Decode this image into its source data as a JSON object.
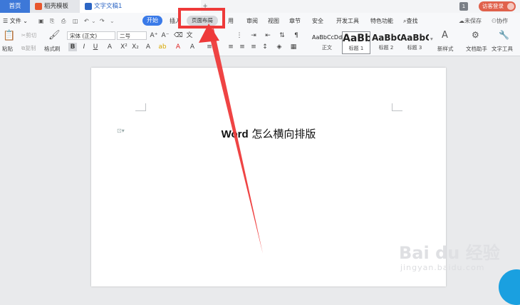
{
  "tabs": {
    "home": "首页",
    "daoke": "稻壳模板",
    "doc": "文字文稿1",
    "add": "+"
  },
  "window": {
    "page_badge": "1",
    "guest_login": "访客登录"
  },
  "menu": {
    "file": "文件",
    "start": "开始",
    "insert": "插入",
    "layout": "页面布局",
    "reference": "用",
    "review": "审阅",
    "view": "视图",
    "chapter": "章节",
    "security": "安全",
    "devtools": "开发工具",
    "features": "特色功能",
    "search": "查找",
    "unsaved": "未保存",
    "collab": "协作"
  },
  "ribbon": {
    "paste": "粘贴",
    "cut": "剪切",
    "copy": "复制",
    "format_painter": "格式刷",
    "font_name": "宋体 (正文)",
    "font_size": "二号",
    "styles": [
      {
        "preview": "AaBbCcDd",
        "caption": "正文"
      },
      {
        "preview": "AaBb",
        "caption": "标题 1"
      },
      {
        "preview": "AaBbC",
        "caption": "标题 2"
      },
      {
        "preview": "AaBbC",
        "caption": "标题 3"
      }
    ],
    "new_style": "新样式",
    "doc_assistant": "文档助手",
    "text_tools": "文字工具"
  },
  "document": {
    "title_bold": "Word",
    "title_rest": " 怎么横向排版"
  },
  "watermark": {
    "brand": "Bai du 经验",
    "url": "jingyan.baidu.com"
  },
  "colors": {
    "accent": "#3a7ae8",
    "highlight": "#ee3a3a",
    "login": "#e0614c"
  }
}
